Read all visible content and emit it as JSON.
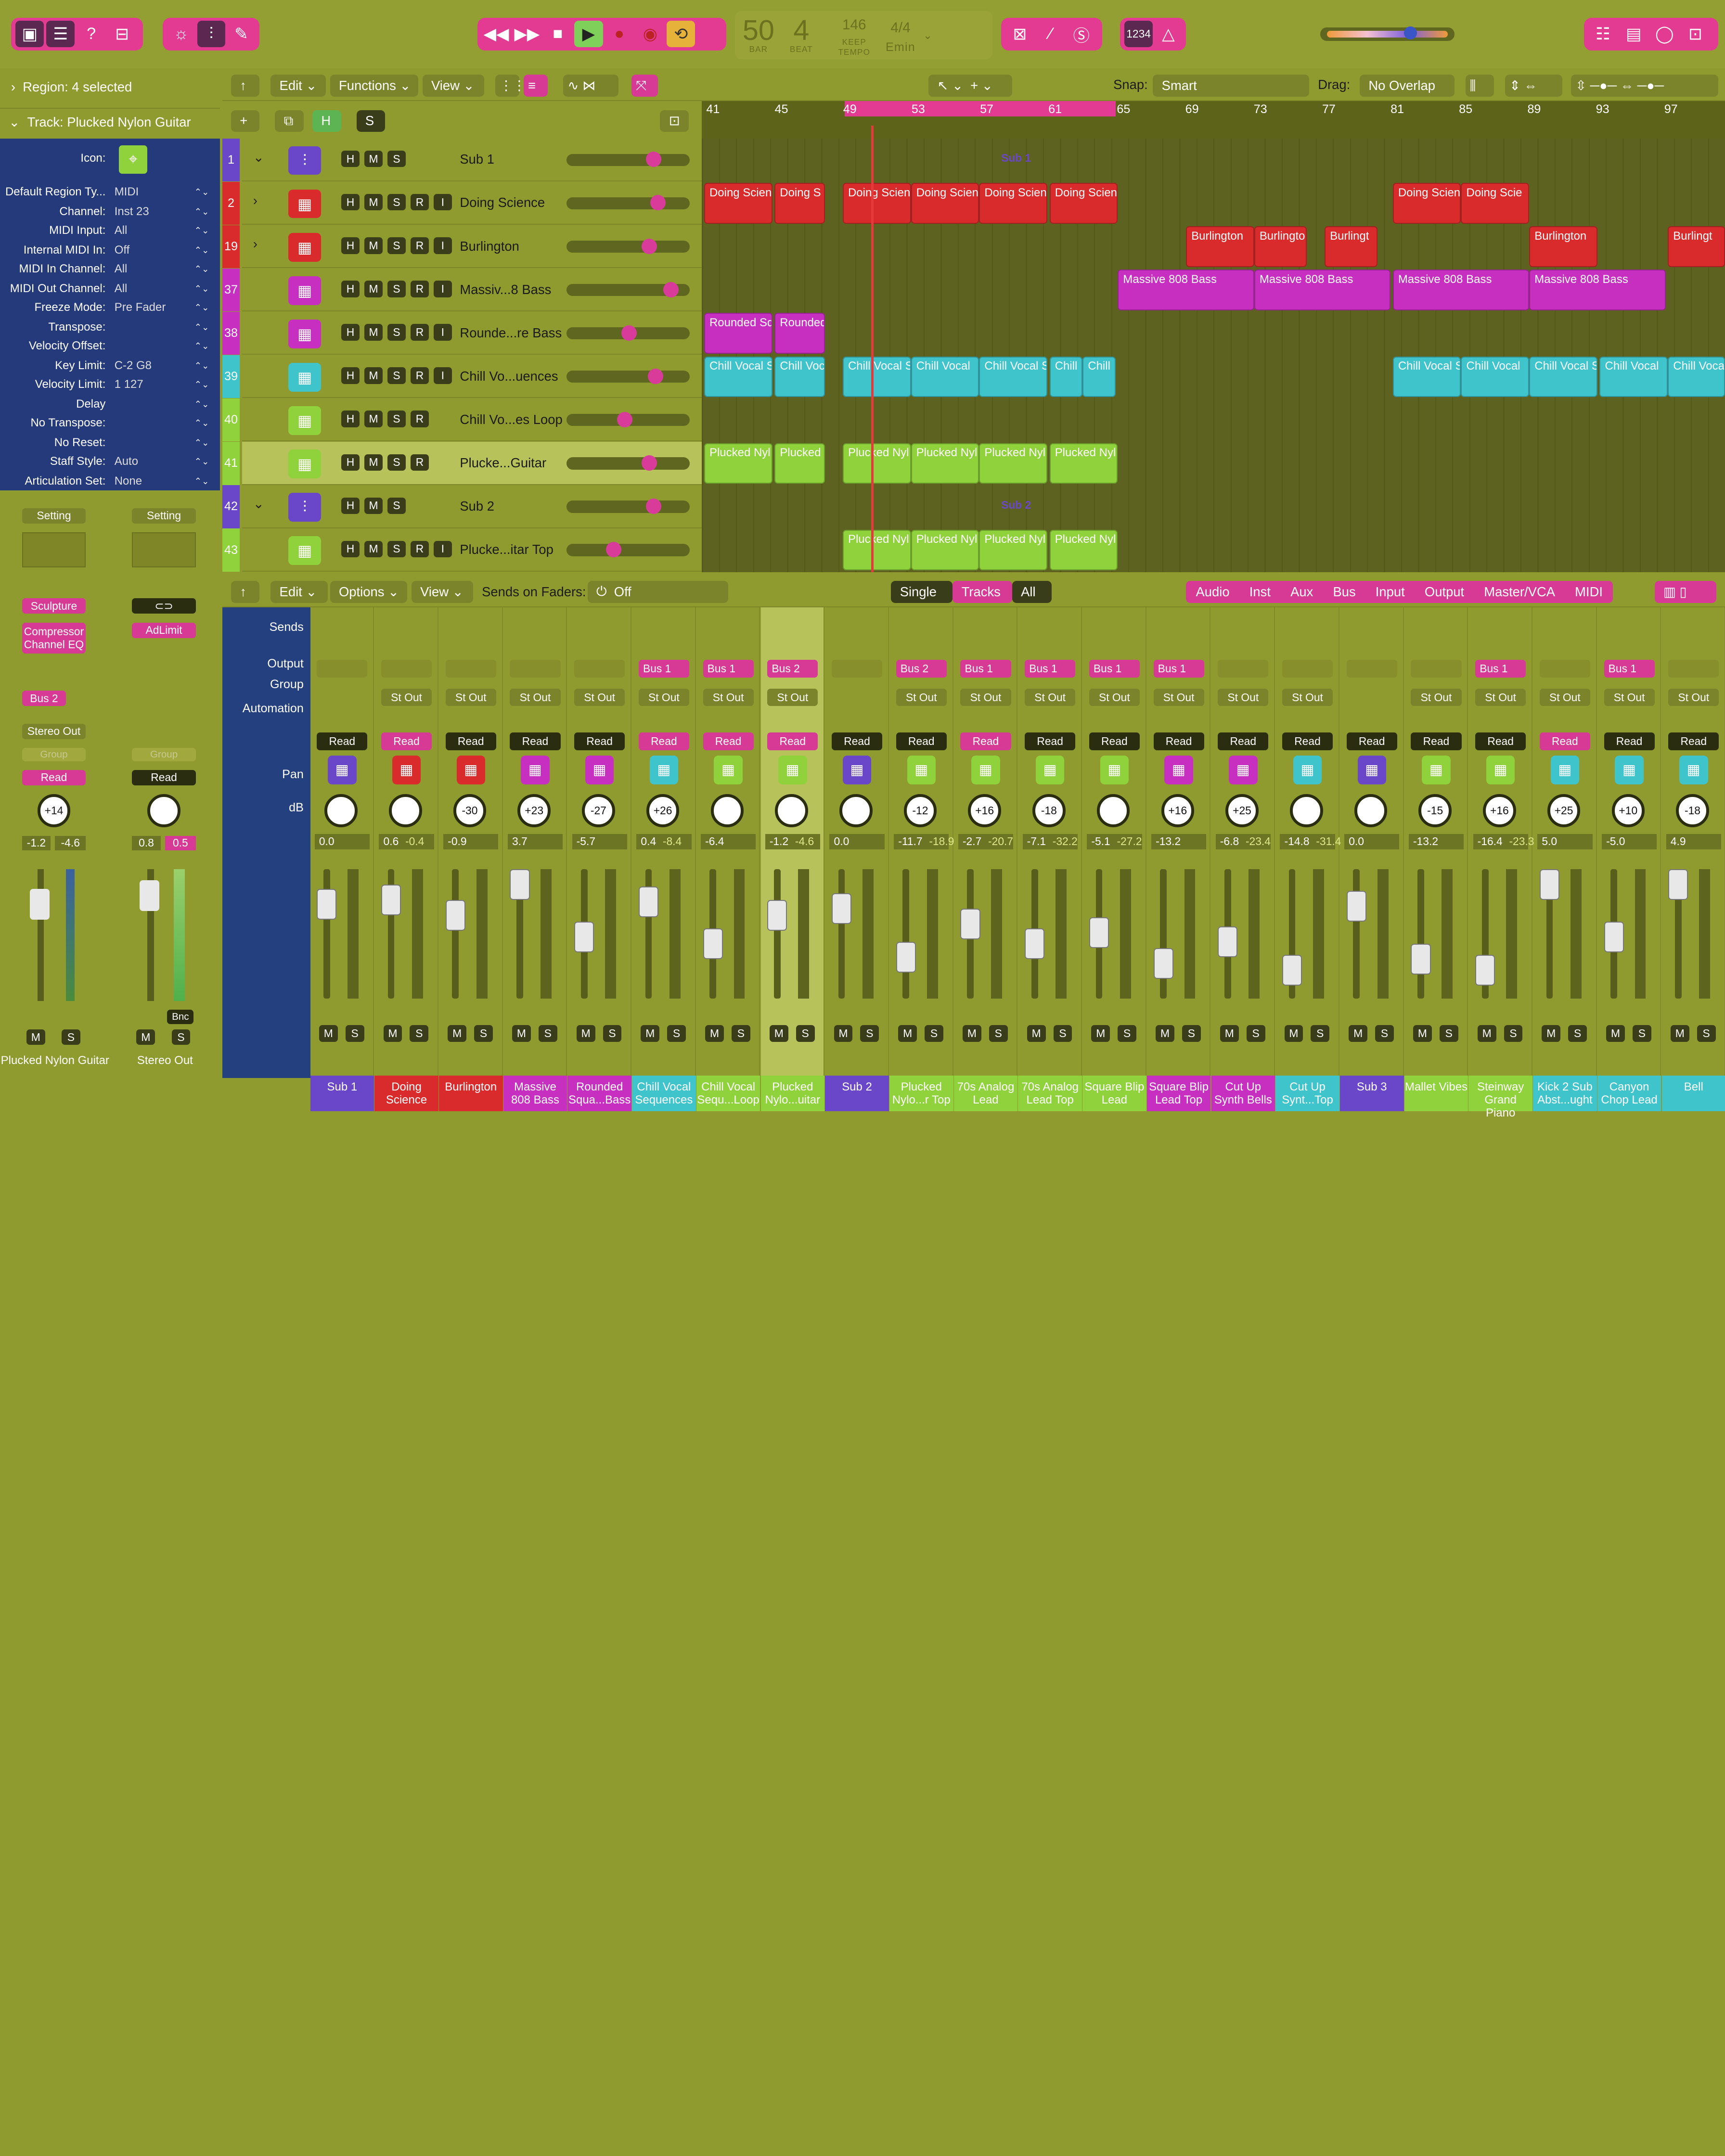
{
  "control_bar": {
    "lcd_bar": "50",
    "lcd_bar_label": "BAR",
    "lcd_beat": "4",
    "lcd_beat_label": "BEAT",
    "tempo": "146",
    "tempo_mode": "KEEP",
    "tempo_label": "TEMPO",
    "signature": "4/4",
    "key": "Emin",
    "count_in": "1234"
  },
  "inspector": {
    "region_header": "Region: 4 selected",
    "track_header": "Track:  Plucked Nylon Guitar",
    "icon_label": "Icon:",
    "rows": [
      {
        "k": "Default Region Ty...",
        "v": "MIDI"
      },
      {
        "k": "Channel:",
        "v": "Inst 23"
      },
      {
        "k": "MIDI Input:",
        "v": "All"
      },
      {
        "k": "Internal MIDI In:",
        "v": "Off"
      },
      {
        "k": "MIDI In Channel:",
        "v": "All"
      },
      {
        "k": "MIDI Out Channel:",
        "v": "All"
      },
      {
        "k": "Freeze Mode:",
        "v": "Pre Fader"
      },
      {
        "k": "Transpose:",
        "v": ""
      },
      {
        "k": "Velocity Offset:",
        "v": ""
      },
      {
        "k": "Key Limit:",
        "v": "C-2  G8"
      },
      {
        "k": "Velocity Limit:",
        "v": "1   127"
      },
      {
        "k": "Delay",
        "v": ""
      },
      {
        "k": "No Transpose:",
        "v": ""
      },
      {
        "k": "No Reset:",
        "v": ""
      },
      {
        "k": "Staff Style:",
        "v": "Auto"
      },
      {
        "k": "Articulation Set:",
        "v": "None"
      }
    ],
    "strip1": {
      "setting": "Setting",
      "plugins": [
        "Sculpture",
        "Compressor",
        "Channel EQ"
      ],
      "send": "Bus 2",
      "output": "Stereo Out",
      "group": "Group",
      "auto": "Read",
      "pan": "+14",
      "db1": "-1.2",
      "db2": "-4.6",
      "name": "Plucked Nylon Guitar",
      "m": "M",
      "s": "S"
    },
    "strip2": {
      "setting": "Setting",
      "plugins": [
        "AdLimit"
      ],
      "output": "",
      "group": "Group",
      "auto": "Read",
      "db1": "0.8",
      "db2": "0.5",
      "bnc": "Bnc",
      "name": "Stereo Out",
      "m": "M",
      "s": "S"
    }
  },
  "tracks_toolbar": {
    "edit": "Edit",
    "functions": "Functions",
    "view": "View",
    "snap_label": "Snap:",
    "snap": "Smart",
    "drag_label": "Drag:",
    "drag": "No Overlap"
  },
  "ruler": [
    "41",
    "45",
    "49",
    "53",
    "57",
    "61",
    "65",
    "69",
    "73",
    "77",
    "81",
    "85",
    "89",
    "93",
    "97"
  ],
  "tracks": [
    {
      "num": "1",
      "name": "Sub 1",
      "color": "#6a46c8",
      "folder": true
    },
    {
      "num": "2",
      "name": "Doing Science",
      "color": "#d92b2b"
    },
    {
      "num": "19",
      "name": "Burlington",
      "color": "#d92b2b"
    },
    {
      "num": "37",
      "name": "Massiv...8 Bass",
      "color": "#c72fc0"
    },
    {
      "num": "38",
      "name": "Rounde...re Bass",
      "color": "#c72fc0"
    },
    {
      "num": "39",
      "name": "Chill Vo...uences",
      "color": "#3fc4cc"
    },
    {
      "num": "40",
      "name": "Chill Vo...es Loop",
      "color": "#8fd23b"
    },
    {
      "num": "41",
      "name": "Plucke...Guitar",
      "color": "#8fd23b"
    },
    {
      "num": "42",
      "name": "Sub 2",
      "color": "#6a46c8",
      "folder": true
    },
    {
      "num": "43",
      "name": "Plucke...itar Top",
      "color": "#8fd23b"
    }
  ],
  "folder_labels": {
    "sub1": "Sub 1",
    "sub2": "Sub 2"
  },
  "regions": {
    "doing": [
      "Doing Scien",
      "Doing S",
      "Doing Scien",
      "Doing Scien",
      "Doing Scien",
      "Doing Scien",
      "Doing Scien",
      "Doing Scie"
    ],
    "burl": [
      "Burlington",
      "Burlingto",
      "Burlingt",
      "Burlington",
      "Burlingt"
    ],
    "massive": [
      "Massive 808 Bass",
      "Massive 808 Bass",
      "Massive 808 Bass",
      "Massive 808 Bass"
    ],
    "rounded": [
      "Rounded Sq",
      "Rounded"
    ],
    "chill": [
      "Chill Vocal S",
      "Chill Voc",
      "Chill Vocal S",
      "Chill Vocal",
      "Chill Vocal S",
      "Chill",
      "Chill",
      "Chill Vocal S",
      "Chill Vocal",
      "Chill Vocal S",
      "Chill Vocal",
      "Chill Voca"
    ],
    "plucked": [
      "Plucked Nyl",
      "Plucked",
      "Plucked Nyl",
      "Plucked Nyl",
      "Plucked Nyl",
      "Plucked Nyl"
    ],
    "plucked2": [
      "Plucked Nyl",
      "Plucked Nyl",
      "Plucked Nyl",
      "Plucked Nyl"
    ]
  },
  "mixer_toolbar": {
    "edit": "Edit",
    "options": "Options",
    "view": "View",
    "sends_label": "Sends on Faders:",
    "sends_value": "Off",
    "single": "Single",
    "tracks": "Tracks",
    "all": "All",
    "filters": [
      "Audio",
      "Inst",
      "Aux",
      "Bus",
      "Input",
      "Output",
      "Master/VCA",
      "MIDI"
    ]
  },
  "mixer_labels": {
    "sends": "Sends",
    "output": "Output",
    "group": "Group",
    "automation": "Automation",
    "pan": "Pan",
    "db": "dB"
  },
  "strips": [
    {
      "name": "Sub 1",
      "color": "#6a46c8",
      "send": "",
      "out": "",
      "auto": "Read",
      "pk": false,
      "pan": "",
      "db": "0.0",
      "db2": ""
    },
    {
      "name": "Doing Science",
      "color": "#d92b2b",
      "send": "",
      "out": "St Out",
      "auto": "Read",
      "pk": true,
      "pan": "",
      "db": "0.6",
      "db2": "-0.4"
    },
    {
      "name": "Burlington",
      "color": "#d92b2b",
      "send": "",
      "out": "St Out",
      "auto": "Read",
      "pk": false,
      "pan": "-30",
      "db": "-0.9",
      "db2": ""
    },
    {
      "name": "Massive 808 Bass",
      "color": "#c72fc0",
      "send": "",
      "out": "St Out",
      "auto": "Read",
      "pk": false,
      "pan": "+23",
      "db": "3.7",
      "db2": ""
    },
    {
      "name": "Rounded Squa...Bass",
      "color": "#c72fc0",
      "send": "",
      "out": "St Out",
      "auto": "Read",
      "pk": false,
      "pan": "-27",
      "db": "-5.7",
      "db2": ""
    },
    {
      "name": "Chill Vocal Sequences",
      "color": "#3fc4cc",
      "send": "Bus 1",
      "out": "St Out",
      "auto": "Read",
      "pk": true,
      "pan": "+26",
      "db": "0.4",
      "db2": "-8.4"
    },
    {
      "name": "Chill Vocal Sequ...Loop",
      "color": "#8fd23b",
      "send": "Bus 1",
      "out": "St Out",
      "auto": "Read",
      "pk": true,
      "pan": "",
      "db": "-6.4",
      "db2": ""
    },
    {
      "name": "Plucked Nylo...uitar",
      "color": "#8fd23b",
      "send": "Bus 2",
      "out": "St Out",
      "auto": "Read",
      "pk": true,
      "pan": "",
      "db": "-1.2",
      "db2": "-4.6"
    },
    {
      "name": "Sub 2",
      "color": "#6a46c8",
      "send": "",
      "out": "",
      "auto": "Read",
      "pk": false,
      "pan": "",
      "db": "0.0",
      "db2": ""
    },
    {
      "name": "Plucked Nylo...r Top",
      "color": "#8fd23b",
      "send": "Bus 2",
      "out": "St Out",
      "auto": "Read",
      "pk": false,
      "pan": "-12",
      "db": "-11.7",
      "db2": "-18.9"
    },
    {
      "name": "70s Analog Lead",
      "color": "#8fd23b",
      "send": "Bus 1",
      "out": "St Out",
      "auto": "Read",
      "pk": true,
      "pan": "+16",
      "db": "-2.7",
      "db2": "-20.7"
    },
    {
      "name": "70s Analog Lead Top",
      "color": "#8fd23b",
      "send": "Bus 1",
      "out": "St Out",
      "auto": "Read",
      "pk": false,
      "pan": "-18",
      "db": "-7.1",
      "db2": "-32.2"
    },
    {
      "name": "Square Blip Lead",
      "color": "#8fd23b",
      "send": "Bus 1",
      "out": "St Out",
      "auto": "Read",
      "pk": false,
      "pan": "",
      "db": "-5.1",
      "db2": "-27.2"
    },
    {
      "name": "Square Blip Lead Top",
      "color": "#c72fc0",
      "send": "Bus 1",
      "out": "St Out",
      "auto": "Read",
      "pk": false,
      "pan": "+16",
      "db": "-13.2",
      "db2": ""
    },
    {
      "name": "Cut Up Synth Bells",
      "color": "#c72fc0",
      "send": "",
      "out": "St Out",
      "auto": "Read",
      "pk": false,
      "pan": "+25",
      "db": "-6.8",
      "db2": "-23.4"
    },
    {
      "name": "Cut Up Synt...Top",
      "color": "#3fc4cc",
      "send": "",
      "out": "St Out",
      "auto": "Read",
      "pk": false,
      "pan": "",
      "db": "-14.8",
      "db2": "-31.4"
    },
    {
      "name": "Sub 3",
      "color": "#6a46c8",
      "send": "",
      "out": "",
      "auto": "Read",
      "pk": false,
      "pan": "",
      "db": "0.0",
      "db2": ""
    },
    {
      "name": "Mallet Vibes",
      "color": "#8fd23b",
      "send": "",
      "out": "St Out",
      "auto": "Read",
      "pk": false,
      "pan": "-15",
      "db": "-13.2",
      "db2": ""
    },
    {
      "name": "Steinway Grand Piano",
      "color": "#8fd23b",
      "send": "Bus 1",
      "out": "St Out",
      "auto": "Read",
      "pk": false,
      "pan": "+16",
      "db": "-16.4",
      "db2": "-23.3"
    },
    {
      "name": "Kick 2 Sub Abst...ught",
      "color": "#3fc4cc",
      "send": "",
      "out": "St Out",
      "auto": "Read",
      "pk": true,
      "pan": "+25",
      "db": "5.0",
      "db2": ""
    },
    {
      "name": "Canyon Chop Lead",
      "color": "#3fc4cc",
      "send": "Bus 1",
      "out": "St Out",
      "auto": "Read",
      "pk": false,
      "pan": "+10",
      "db": "-5.0",
      "db2": ""
    },
    {
      "name": "Bell",
      "color": "#3fc4cc",
      "send": "",
      "out": "St Out",
      "auto": "Read",
      "pk": false,
      "pan": "-18",
      "db": "4.9",
      "db2": ""
    }
  ]
}
